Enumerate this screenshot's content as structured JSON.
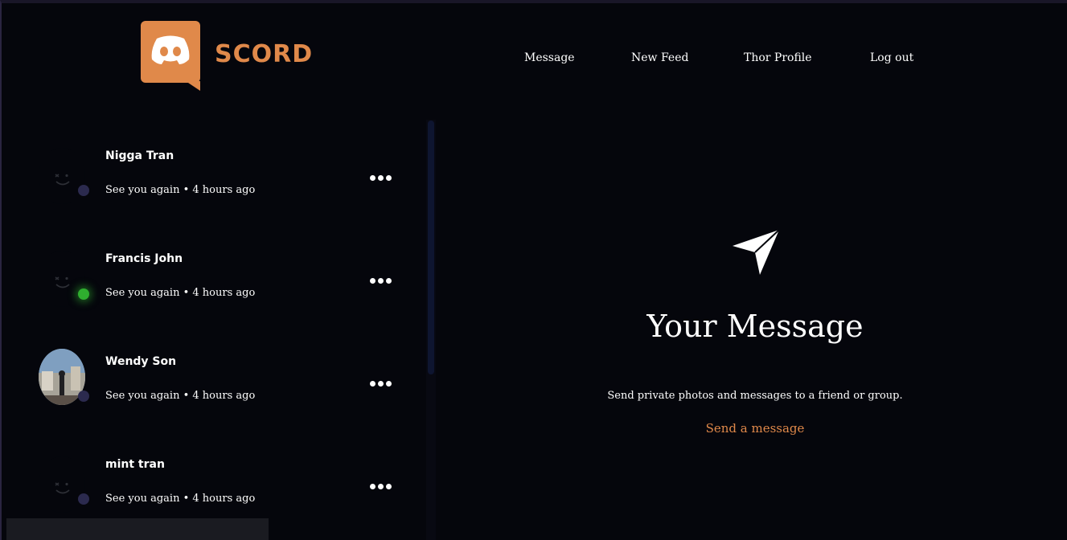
{
  "brand": {
    "name": "SCORD",
    "icon": "discord-logo-icon",
    "accent_color": "#e0894a"
  },
  "nav": {
    "items": [
      {
        "label": "Message"
      },
      {
        "label": "New Feed"
      },
      {
        "label": "Thor Profile"
      },
      {
        "label": "Log out"
      }
    ]
  },
  "conversations": [
    {
      "name": "Nigga Tran",
      "preview": "See you again • 4 hours ago",
      "avatar": "placeholder-face-icon",
      "status": "offline",
      "more_icon": "more-horizontal-icon"
    },
    {
      "name": "Francis John",
      "preview": "See you again • 4 hours ago",
      "avatar": "placeholder-face-icon",
      "status": "online",
      "more_icon": "more-horizontal-icon"
    },
    {
      "name": "Wendy Son",
      "preview": "See you again • 4 hours ago",
      "avatar": "user-photo",
      "status": "offline",
      "more_icon": "more-horizontal-icon"
    },
    {
      "name": "mint tran",
      "preview": "See you again • 4 hours ago",
      "avatar": "placeholder-face-icon",
      "status": "offline",
      "more_icon": "more-horizontal-icon"
    }
  ],
  "status_colors": {
    "online": "#2fae2f",
    "offline": "#2b2a4e"
  },
  "empty_state": {
    "icon": "paper-plane-send-icon",
    "title": "Your Message",
    "description": "Send private photos and messages to a friend or group.",
    "action_label": "Send a message"
  }
}
